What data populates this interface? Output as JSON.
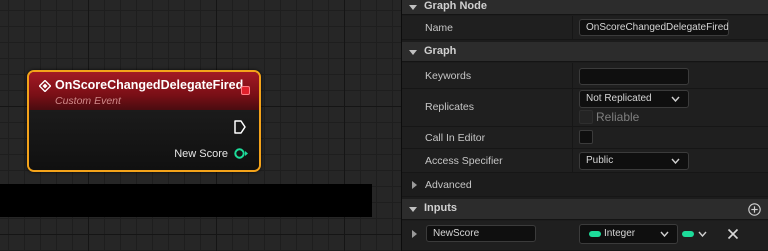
{
  "graph": {
    "node": {
      "title": "OnScoreChangedDelegateFired",
      "subtitle": "Custom Event",
      "output_pin_label": "New Score",
      "header_color": "#a31a24",
      "border_color": "#f4a31a",
      "pin_color": "#1ddc9a",
      "icons": {
        "event": "event-diamond-icon",
        "delegate": "delegate-pin-icon",
        "exec": "exec-pin-icon",
        "data": "integer-pin-icon"
      }
    }
  },
  "details": {
    "graph_node": {
      "section_label": "Graph Node",
      "name_label": "Name",
      "name_value": "OnScoreChangedDelegateFired"
    },
    "graph": {
      "section_label": "Graph",
      "keywords_label": "Keywords",
      "keywords_value": "",
      "replicates_label": "Replicates",
      "replicates_value": "Not Replicated",
      "reliable_label": "Reliable",
      "call_in_editor_label": "Call In Editor",
      "access_specifier_label": "Access Specifier",
      "access_specifier_value": "Public"
    },
    "advanced": {
      "section_label": "Advanced"
    },
    "inputs": {
      "section_label": "Inputs",
      "params": [
        {
          "name": "NewScore",
          "type": "Integer",
          "type_color": "#1ddc9a"
        }
      ]
    }
  }
}
